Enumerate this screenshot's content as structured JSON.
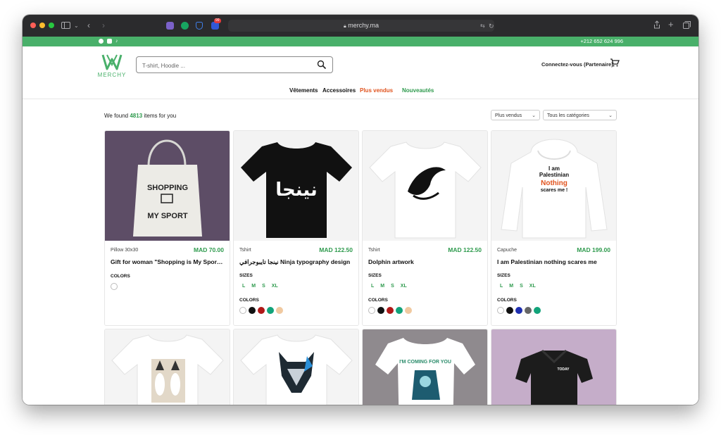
{
  "browser": {
    "url": "merchy.ma",
    "extension_badge": "99"
  },
  "topbar": {
    "phone": "+212 652 624 996",
    "accent": "#49b06a"
  },
  "header": {
    "logo_text": "MERCHY",
    "search_placeholder": "T-shirt, Hoodie ...",
    "login_label": "Connectez-vous (Partenaire)"
  },
  "nav": [
    {
      "label": "Vêtements",
      "color": "#111111"
    },
    {
      "label": "Accessoires",
      "color": "#111111"
    },
    {
      "label": "Plus vendus",
      "color": "#e0531e"
    },
    {
      "label": "Nouveautés",
      "color": "#2e9a4d"
    }
  ],
  "results": {
    "prefix": "We found",
    "count": "4813",
    "suffix": "items for you",
    "sort_value": "Plus vendus",
    "category_value": "Tous les catégories"
  },
  "products": [
    {
      "category": "Pillow 30x30",
      "price": "MAD 70.00",
      "title": "Gift for woman \"Shopping is My Sport \"...",
      "sizes_label": "",
      "sizes": [],
      "colors_label": "COLORS",
      "colors": [
        "#ffffff"
      ]
    },
    {
      "category": "Tshirt",
      "price": "MAD 122.50",
      "title": "نينجا تايبوجرافي Ninja typography design",
      "sizes_label": "SIZES",
      "sizes": [
        "L",
        "M",
        "S",
        "XL"
      ],
      "colors_label": "COLORS",
      "colors": [
        "#ffffff",
        "#111111",
        "#b01818",
        "#12a37a",
        "#f0c9a0"
      ]
    },
    {
      "category": "Tshirt",
      "price": "MAD 122.50",
      "title": "Dolphin artwork",
      "sizes_label": "SIZES",
      "sizes": [
        "L",
        "M",
        "S",
        "XL"
      ],
      "colors_label": "COLORS",
      "colors": [
        "#ffffff",
        "#111111",
        "#b01818",
        "#12a37a",
        "#f0c9a0"
      ]
    },
    {
      "category": "Capuche",
      "price": "MAD 199.00",
      "title": "I am Palestinian nothing scares me",
      "sizes_label": "SIZES",
      "sizes": [
        "L",
        "M",
        "S",
        "XL"
      ],
      "colors_label": "COLORS",
      "colors": [
        "#ffffff",
        "#111111",
        "#1f2fb0",
        "#666666",
        "#12a37a"
      ]
    }
  ],
  "artwork": {
    "tote_line1": "SHOPPING",
    "tote_line2": "MY SPORT",
    "ninja_word": "نينجا",
    "hoodie_line1": "I am",
    "hoodie_line2": "Palestinian",
    "hoodie_line3": "Nothing",
    "hoodie_line4": "scares me !",
    "shirt7_text": "I'M COMING FOR YOU",
    "polo_text": "TODAY"
  }
}
